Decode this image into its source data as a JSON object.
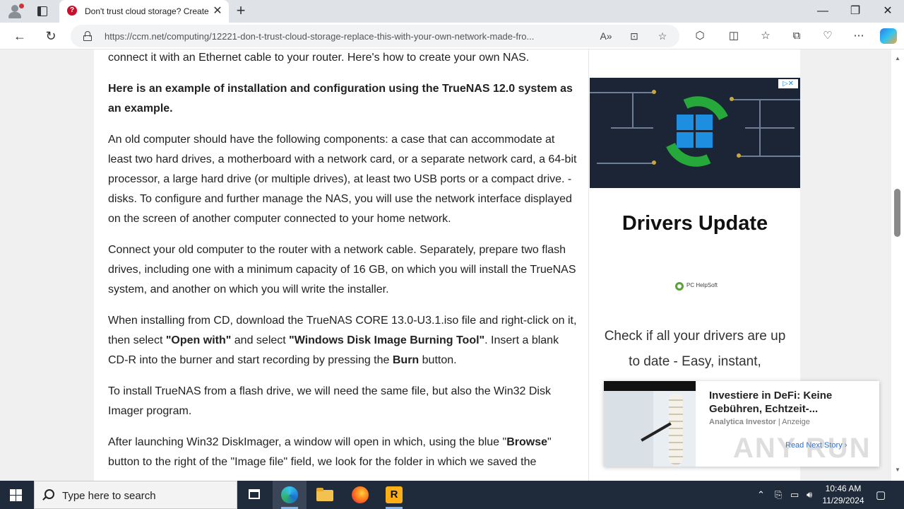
{
  "browser": {
    "tab": {
      "title": "Don't trust cloud storage? Create",
      "favicon": "ccm-favicon",
      "close": "✕"
    },
    "new_tab": "+",
    "window_controls": {
      "minimize": "—",
      "maximize": "❐",
      "close": "✕"
    },
    "url": "https://ccm.net/computing/12221-don-t-trust-cloud-storage-replace-this-with-your-own-network-made-fro...",
    "icons": {
      "read_aloud": "A»",
      "immersive": "⊡",
      "favorite": "☆",
      "extensions": "⬡",
      "split": "◫",
      "favorites": "☆",
      "collections": "⧉",
      "performance": "♡",
      "menu": "⋯"
    }
  },
  "article": {
    "p1": "connect it with an Ethernet cable to your router. Here's how to create your own NAS.",
    "p2": "Here is an example of installation and configuration using the TrueNAS 12.0 system as an example.",
    "p3": "An old computer should have the following components: a case that can accommodate at least two hard drives, a motherboard with a network card, or a separate network card, a 64-bit processor, a large hard drive (or multiple drives), at least two USB ports or a compact drive. -disks. To configure and further manage the NAS, you will use the network interface displayed on the screen of another computer connected to your home network.",
    "p4": "Connect your old computer to the router with a network cable. Separately, prepare two flash drives, including one with a minimum capacity of 16 GB, on which you will install the TrueNAS system, and another on which you will write the installer.",
    "p5_a": "When installing from CD, download the TrueNAS CORE 13.0-U3.1.iso file and right-click on it, then select ",
    "p5_b": "\"Open with\"",
    "p5_c": " and select ",
    "p5_d": "\"Windows Disk Image Burning Tool\"",
    "p5_e": ". Insert a blank CD-R into the burner and start recording by pressing the ",
    "p5_f": "Burn",
    "p5_g": " button.",
    "p6": "To install TrueNAS from a flash drive, we will need the same file, but also the Win32 Disk Imager program.",
    "p7_a": "After launching Win32 DiskImager, a window will open in which, using the blue \"",
    "p7_b": "Browse",
    "p7_c": "\" button to the right of the \"Image file\" field, we look for the folder in which we saved the"
  },
  "sidebar_ad": {
    "badge": "▷✕",
    "headline": "Drivers Update",
    "brand": "PC HelpSoft",
    "copy": "Check if all your drivers are up to date - Easy, instant,"
  },
  "native_ad": {
    "title": "Investiere in DeFi: Keine Gebühren, Echtzeit-...",
    "source": "Analytica Investor",
    "label": "Anzeige",
    "cta": "Read Next Story ›"
  },
  "watermark": "ANY RUN",
  "taskbar": {
    "search_placeholder": "Type here to search",
    "time": "10:46 AM",
    "date": "11/29/2024"
  },
  "colors": {
    "accent": "#2b6fc8",
    "taskbar": "#1f2a3a",
    "ad_green": "#27a83a"
  }
}
